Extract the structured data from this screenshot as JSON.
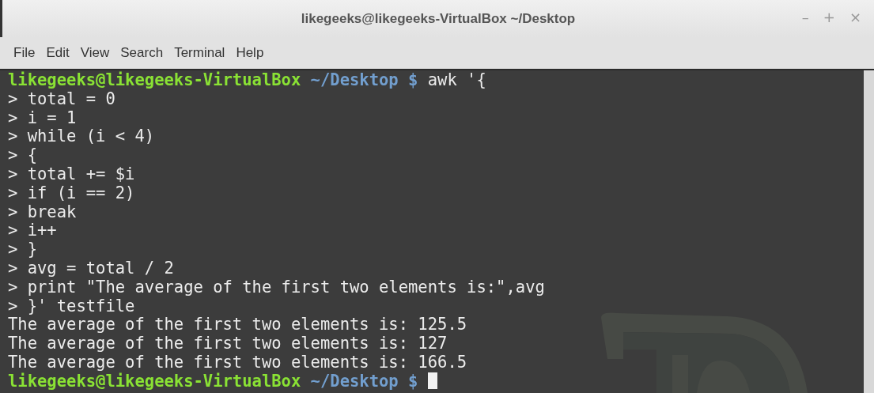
{
  "window": {
    "title": "likegeeks@likegeeks-VirtualBox ~/Desktop",
    "controls": [
      "–",
      "+",
      "×"
    ]
  },
  "menu": [
    "File",
    "Edit",
    "View",
    "Search",
    "Terminal",
    "Help"
  ],
  "terminal": {
    "lines": [
      {
        "kind": "prompt",
        "user": "likegeeks@likegeeks-VirtualBox",
        "path": "~/Desktop",
        "symbol": "$",
        "command": "awk '{"
      },
      {
        "kind": "text",
        "text": "> total = 0"
      },
      {
        "kind": "text",
        "text": "> i = 1"
      },
      {
        "kind": "text",
        "text": "> while (i < 4)"
      },
      {
        "kind": "text",
        "text": "> {"
      },
      {
        "kind": "text",
        "text": "> total += $i"
      },
      {
        "kind": "text",
        "text": "> if (i == 2)"
      },
      {
        "kind": "text",
        "text": "> break"
      },
      {
        "kind": "text",
        "text": "> i++"
      },
      {
        "kind": "text",
        "text": "> }"
      },
      {
        "kind": "text",
        "text": "> avg = total / 2"
      },
      {
        "kind": "text",
        "text": "> print \"The average of the first two elements is:\",avg"
      },
      {
        "kind": "text",
        "text": "> }' testfile"
      },
      {
        "kind": "text",
        "text": "The average of the first two elements is: 125.5"
      },
      {
        "kind": "text",
        "text": "The average of the first two elements is: 127"
      },
      {
        "kind": "text",
        "text": "The average of the first two elements is: 166.5"
      },
      {
        "kind": "prompt",
        "user": "likegeeks@likegeeks-VirtualBox",
        "path": "~/Desktop",
        "symbol": "$",
        "cursor": true
      }
    ]
  }
}
